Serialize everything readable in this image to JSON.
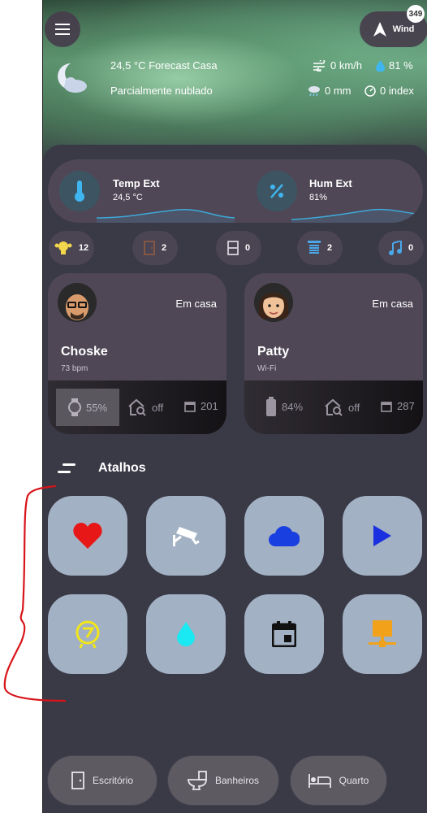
{
  "header": {
    "forecast_title": "24,5 °C Forecast Casa",
    "condition": "Parcialmente nublado",
    "wind_speed": "0 km/h",
    "humidity": "81 %",
    "rain": "0 mm",
    "index": "0 index",
    "wind_label": "Wind",
    "wind_badge": "349"
  },
  "sensors": [
    {
      "name": "Temp Ext",
      "value": "24,5 °C",
      "icon": "thermometer-icon"
    },
    {
      "name": "Hum Ext",
      "value": "81%",
      "icon": "percent-icon"
    }
  ],
  "chips": [
    {
      "icon": "lightbulb-group-icon",
      "count": "12",
      "color": "#f2d64b"
    },
    {
      "icon": "door-icon",
      "count": "2",
      "color": "#8a5a44"
    },
    {
      "icon": "window-icon",
      "count": "0",
      "color": "#d8d2dc"
    },
    {
      "icon": "blinds-icon",
      "count": "2",
      "color": "#4aa8e8"
    },
    {
      "icon": "music-icon",
      "count": "0",
      "color": "#4aa8e8"
    }
  ],
  "persons": [
    {
      "name": "Choske",
      "state": "Em casa",
      "sub": "73 bpm",
      "battery": "55%",
      "presence": "off",
      "steps": "201"
    },
    {
      "name": "Patty",
      "state": "Em casa",
      "sub": "Wi-Fi",
      "battery": "84%",
      "presence": "off",
      "steps": "287"
    }
  ],
  "shortcuts_title": "Atalhos",
  "shortcuts": [
    {
      "icon": "heart-icon",
      "color": "#e81717"
    },
    {
      "icon": "cctv-icon",
      "color": "#ffffff"
    },
    {
      "icon": "cloud-icon",
      "color": "#1a3fe0"
    },
    {
      "icon": "play-icon",
      "color": "#1a2fe0"
    },
    {
      "icon": "robot-vacuum-icon",
      "color": "#f2e61a"
    },
    {
      "icon": "water-drop-icon",
      "color": "#1ae8f2"
    },
    {
      "icon": "calendar-icon",
      "color": "#111111"
    },
    {
      "icon": "network-icon",
      "color": "#f2a21a"
    }
  ],
  "rooms": [
    {
      "label": "Escritório",
      "icon": "door-icon"
    },
    {
      "label": "Banheiros",
      "icon": "toilet-icon"
    },
    {
      "label": "Quarto",
      "icon": "bed-icon"
    }
  ]
}
